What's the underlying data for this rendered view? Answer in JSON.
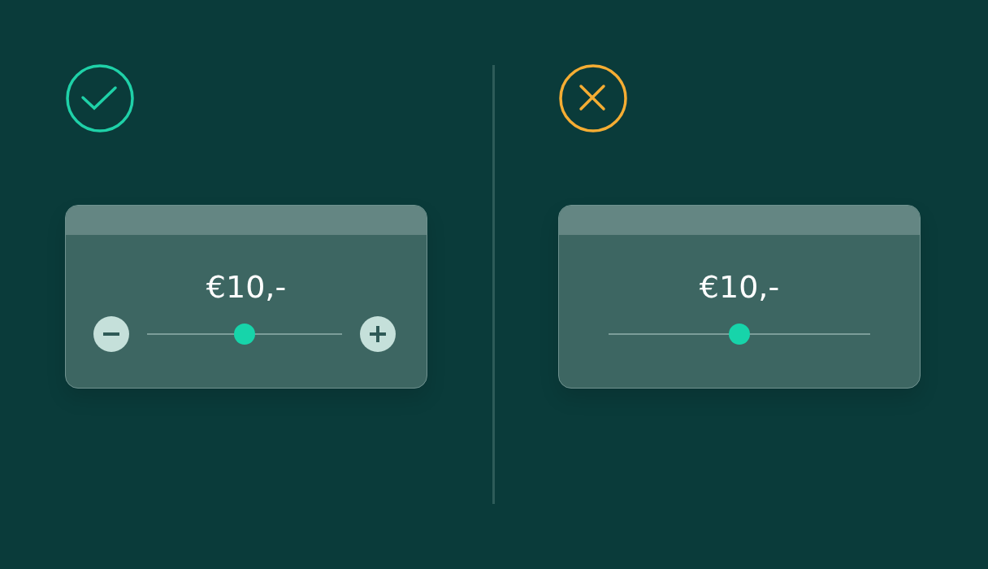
{
  "panels": [
    {
      "verdict": {
        "kind": "check"
      },
      "card": {
        "price": "€10,-",
        "has_steppers": true,
        "slider": {
          "level": 0.5
        }
      }
    },
    {
      "verdict": {
        "kind": "cross"
      },
      "card": {
        "price": "€10,-",
        "has_steppers": false,
        "slider": {
          "level": 0.5
        }
      }
    }
  ]
}
